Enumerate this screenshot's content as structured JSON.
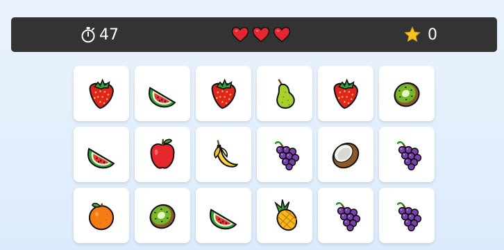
{
  "hud": {
    "timer_icon": "stopwatch-icon",
    "timer_value": "47",
    "lives": 3,
    "life_icon": "heart-icon",
    "score_icon": "star-icon",
    "score_value": "0"
  },
  "colors": {
    "hud_background": "#333333",
    "heart": "#e3262f",
    "star": "#f5c422",
    "card_background": "#ffffff"
  },
  "board": {
    "columns": 6,
    "cards": [
      {
        "fruit": "strawberry-icon"
      },
      {
        "fruit": "watermelon-icon"
      },
      {
        "fruit": "strawberry-icon"
      },
      {
        "fruit": "pear-icon"
      },
      {
        "fruit": "strawberry-icon"
      },
      {
        "fruit": "kiwi-icon"
      },
      {
        "fruit": "watermelon-icon"
      },
      {
        "fruit": "apple-icon"
      },
      {
        "fruit": "banana-icon"
      },
      {
        "fruit": "grapes-icon"
      },
      {
        "fruit": "coconut-icon"
      },
      {
        "fruit": "grapes-icon"
      },
      {
        "fruit": "orange-icon"
      },
      {
        "fruit": "kiwi-icon"
      },
      {
        "fruit": "watermelon-icon"
      },
      {
        "fruit": "pineapple-icon"
      },
      {
        "fruit": "grapes-icon"
      },
      {
        "fruit": "grapes-icon"
      }
    ]
  }
}
